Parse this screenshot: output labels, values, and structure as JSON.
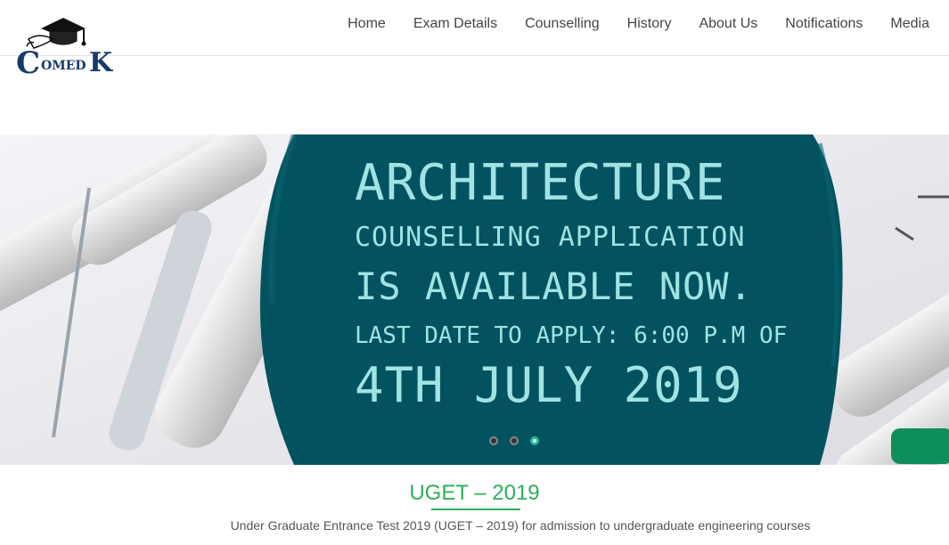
{
  "brand": {
    "logo_letters": [
      "C",
      "OMED",
      "K"
    ]
  },
  "nav": {
    "items": [
      "Home",
      "Exam Details",
      "Counselling",
      "History",
      "About Us",
      "Notifications",
      "Media"
    ]
  },
  "hero": {
    "line1": "ARCHITECTURE",
    "line2": "COUNSELLING APPLICATION",
    "line3": "IS AVAILABLE NOW.",
    "line4": "LAST DATE TO APPLY: 6:00 P.M OF",
    "line5": "4TH JULY 2019",
    "slide_count": 3,
    "active_slide": 3,
    "colors": {
      "panel": "#03525f",
      "text": "#9fe3e3"
    }
  },
  "section": {
    "title": "UGET – 2019",
    "description": "Under Graduate Entrance Test 2019 (UGET – 2019) for admission to undergraduate engineering courses"
  },
  "colors": {
    "accent": "#2bb05a",
    "nav_text": "#444444"
  }
}
